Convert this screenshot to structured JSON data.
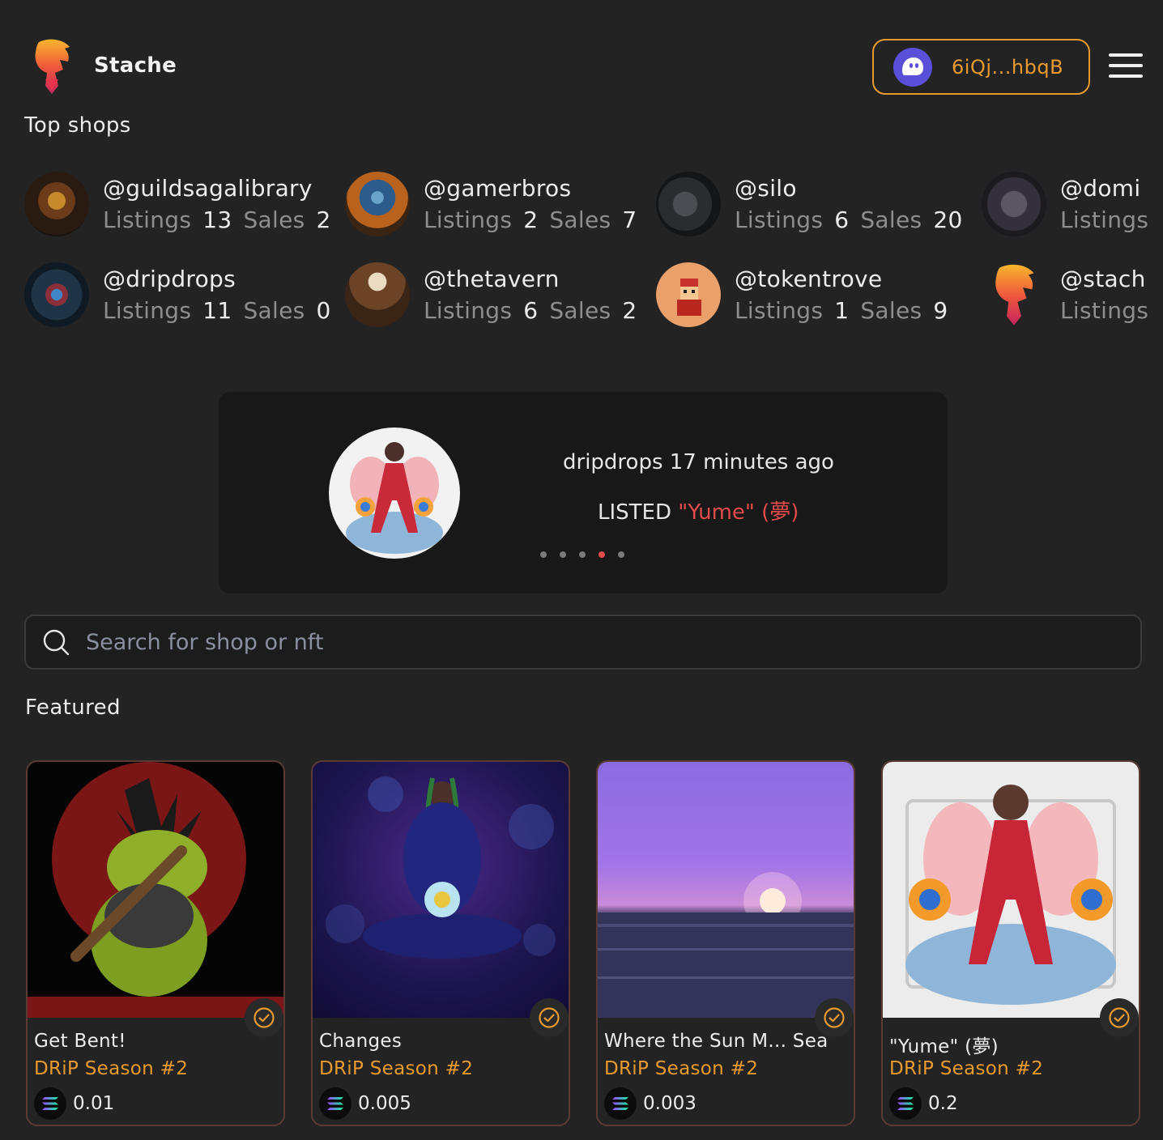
{
  "header": {
    "brand": "Stache",
    "wallet_address": "6iQj...hbqB"
  },
  "top_shops": {
    "title": "Top shops",
    "listings_label": "Listings",
    "sales_label": "Sales",
    "shops": [
      {
        "handle": "@guildsagalibrary",
        "listings": "13",
        "sales": "2"
      },
      {
        "handle": "@gamerbros",
        "listings": "2",
        "sales": "7"
      },
      {
        "handle": "@silo",
        "listings": "6",
        "sales": "20"
      },
      {
        "handle": "@domi",
        "listings": "",
        "sales": ""
      },
      {
        "handle": "@dripdrops",
        "listings": "11",
        "sales": "0"
      },
      {
        "handle": "@thetavern",
        "listings": "6",
        "sales": "2"
      },
      {
        "handle": "@tokentrove",
        "listings": "1",
        "sales": "9"
      },
      {
        "handle": "@stach",
        "listings": "",
        "sales": ""
      }
    ]
  },
  "activity": {
    "line1": "dripdrops 17 minutes ago",
    "action": "LISTED",
    "item": "\"Yume\" (夢)",
    "dots_count": 5,
    "active_dot": 3
  },
  "search": {
    "placeholder": "Search for shop or nft"
  },
  "featured": {
    "title": "Featured",
    "items": [
      {
        "name": "Get Bent!",
        "collection": "DRiP Season #2",
        "price": "0.01"
      },
      {
        "name": "Changes",
        "collection": "DRiP Season #2",
        "price": "0.005"
      },
      {
        "name": "Where the Sun M... Sea",
        "collection": "DRiP Season #2",
        "price": "0.003"
      },
      {
        "name": "\"Yume\" (夢)",
        "collection": "DRiP Season #2",
        "price": "0.2"
      }
    ]
  },
  "colors": {
    "accent": "#e89a2e",
    "highlight": "#e24b4b",
    "background": "#232323"
  }
}
